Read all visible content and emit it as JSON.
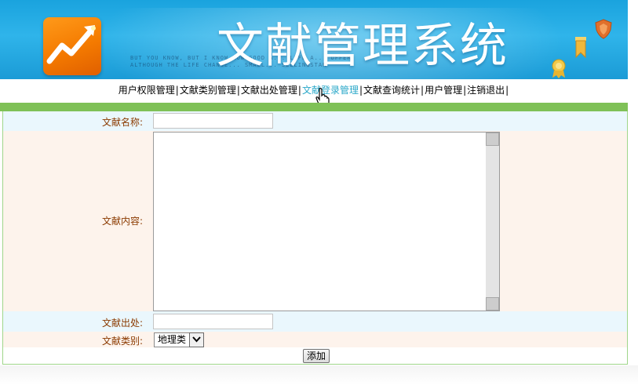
{
  "banner": {
    "title": "文献管理系统",
    "fine_print_line1": "BUT YOU KNOW, BUT I KNOW HOW GOOD A... LIFE A... OFFER",
    "fine_print_line2": "ALTHOUGH THE LIFE CHANGE... SMALL... SELLINGSTAR"
  },
  "nav": {
    "items": [
      {
        "label": "用户权限管理",
        "active": false
      },
      {
        "label": "文献类别管理",
        "active": false
      },
      {
        "label": "文献出处管理",
        "active": false
      },
      {
        "label": "文献登录管理",
        "active": true
      },
      {
        "label": "文献查询统计",
        "active": false
      },
      {
        "label": "用户管理",
        "active": false
      },
      {
        "label": "注销退出",
        "active": false
      }
    ],
    "separator": "|"
  },
  "form": {
    "name_label": "文献名称:",
    "name_value": "",
    "content_label": "文献内容:",
    "content_value": "",
    "source_label": "文献出处:",
    "source_value": "",
    "type_label": "文献类别:",
    "type_selected": "地理类",
    "submit_label": "添加"
  },
  "colors": {
    "banner": "#1aa3de",
    "nav_active": "#2aa8c9",
    "green_bar": "#7fc157",
    "label_text": "#8b3a00",
    "row_blue": "#eaf7fd",
    "row_peach": "#fdf3ec"
  },
  "icons": {
    "logo": "growth-arrow-logo-icon",
    "bookmark": "bookmark-icon",
    "shield": "shield-icon",
    "medal": "medal-icon",
    "cursor": "hand-pointer-icon",
    "dropdown": "chevron-down-icon"
  }
}
